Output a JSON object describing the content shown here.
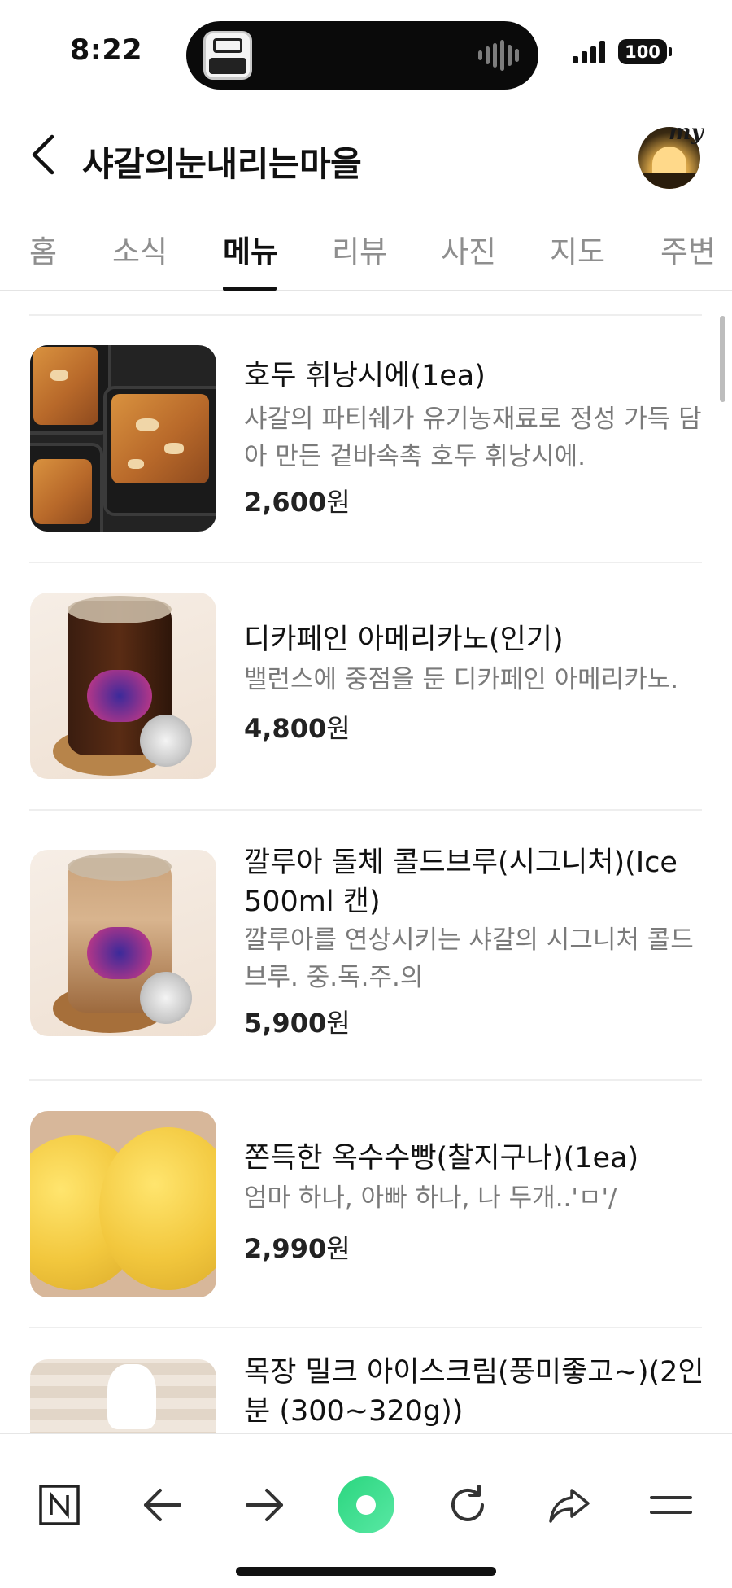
{
  "status_bar": {
    "time": "8:22",
    "battery": "100",
    "island_icon": "app-badge-icon",
    "island_wave_icon": "audio-wave-icon"
  },
  "header": {
    "back_icon": "chevron-left-icon",
    "title": "샤갈의눈내리는마을",
    "my_label": "my"
  },
  "tabs": [
    {
      "label": "홈",
      "active": false
    },
    {
      "label": "소식",
      "active": false
    },
    {
      "label": "메뉴",
      "active": true
    },
    {
      "label": "리뷰",
      "active": false
    },
    {
      "label": "사진",
      "active": false
    },
    {
      "label": "지도",
      "active": false
    },
    {
      "label": "주변",
      "active": false
    }
  ],
  "menu": {
    "items": [
      {
        "name": "호두 휘낭시에(1ea)",
        "description": "샤갈의 파티쉐가 유기농재료로 정성 가득 담아 만든 겉바속촉 호두 휘낭시에.",
        "price": "2,600",
        "unit": "원"
      },
      {
        "name": "디카페인 아메리카노(인기)",
        "description": "밸런스에 중점을 둔 디카페인 아메리카노.",
        "price": "4,800",
        "unit": "원"
      },
      {
        "name": "깔루아 돌체 콜드브루(시그니처)(Ice 500ml 캔)",
        "description": "깔루아를 연상시키는 샤갈의 시그니처 콜드브루. 중.독.주.의",
        "price": "5,900",
        "unit": "원"
      },
      {
        "name": "쫀득한 옥수수빵(찰지구나)(1ea)",
        "description": "엄마 하나, 아빠 하나, 나 두개..'ㅁ'/",
        "price": "2,990",
        "unit": "원"
      },
      {
        "name": "목장 밀크 아이스크림(풍미좋고~)(2인분 (300~320g))",
        "description": "",
        "price": "",
        "unit": ""
      }
    ]
  },
  "bottom_bar": {
    "icons": [
      "naver-n-icon",
      "back-arrow-icon",
      "forward-arrow-icon",
      "green-dot-icon",
      "refresh-icon",
      "share-icon",
      "menu-icon"
    ]
  },
  "colors": {
    "accent_green": "#2bd67f",
    "text_primary": "#111111",
    "text_secondary": "#7a7a7a",
    "tab_inactive": "#8e8e8e"
  }
}
